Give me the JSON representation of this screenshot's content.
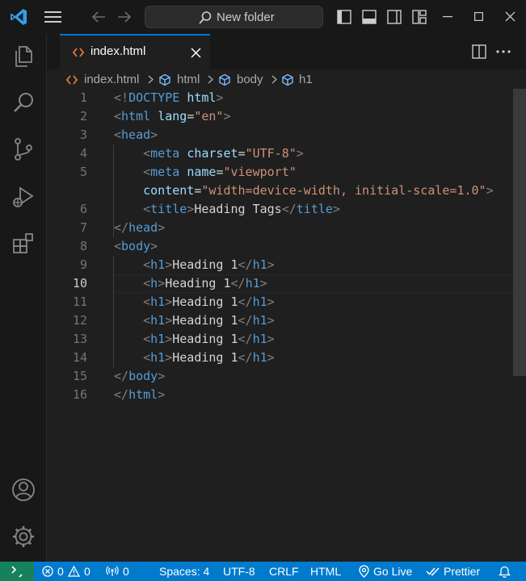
{
  "titlebar": {
    "search_label": "New folder",
    "icons": [
      "vscode-logo-icon",
      "hamburger-menu-icon",
      "back-arrow-icon",
      "forward-arrow-icon",
      "search-icon",
      "toggle-primary-sidebar-icon",
      "toggle-panel-icon",
      "toggle-secondary-sidebar-icon",
      "customize-layout-icon",
      "minimize-icon",
      "maximize-icon",
      "close-icon"
    ]
  },
  "activity_bar": {
    "items": [
      "explorer-icon",
      "search-icon",
      "source-control-icon",
      "run-debug-icon",
      "extensions-icon"
    ],
    "bottom": [
      "accounts-icon",
      "manage-gear-icon"
    ]
  },
  "tab": {
    "label": "index.html"
  },
  "breadcrumb": [
    "index.html",
    "html",
    "body",
    "h1"
  ],
  "editor": {
    "active_line": "10",
    "lines": [
      {
        "n": "1",
        "tokens": [
          {
            "c": "t",
            "v": "<!"
          },
          {
            "c": "tn",
            "v": "DOCTYPE"
          },
          {
            "c": "tx",
            "v": " "
          },
          {
            "c": "at",
            "v": "html"
          },
          {
            "c": "t",
            "v": ">"
          }
        ]
      },
      {
        "n": "2",
        "tokens": [
          {
            "c": "t",
            "v": "<"
          },
          {
            "c": "tn",
            "v": "html"
          },
          {
            "c": "tx",
            "v": " "
          },
          {
            "c": "at",
            "v": "lang"
          },
          {
            "c": "tx",
            "v": "="
          },
          {
            "c": "st",
            "v": "\"en\""
          },
          {
            "c": "t",
            "v": ">"
          }
        ]
      },
      {
        "n": "3",
        "tokens": [
          {
            "c": "t",
            "v": "<"
          },
          {
            "c": "tn",
            "v": "head"
          },
          {
            "c": "t",
            "v": ">"
          }
        ]
      },
      {
        "n": "4",
        "tokens": [
          {
            "c": "tx",
            "v": "    "
          },
          {
            "c": "t",
            "v": "<"
          },
          {
            "c": "tn",
            "v": "meta"
          },
          {
            "c": "tx",
            "v": " "
          },
          {
            "c": "at",
            "v": "charset"
          },
          {
            "c": "tx",
            "v": "="
          },
          {
            "c": "st",
            "v": "\"UTF-8\""
          },
          {
            "c": "t",
            "v": ">"
          }
        ]
      },
      {
        "n": "5",
        "tokens": [
          {
            "c": "tx",
            "v": "    "
          },
          {
            "c": "t",
            "v": "<"
          },
          {
            "c": "tn",
            "v": "meta"
          },
          {
            "c": "tx",
            "v": " "
          },
          {
            "c": "at",
            "v": "name"
          },
          {
            "c": "tx",
            "v": "="
          },
          {
            "c": "st",
            "v": "\"viewport\""
          }
        ]
      },
      {
        "n": "",
        "tokens": [
          {
            "c": "tx",
            "v": "    "
          },
          {
            "c": "at",
            "v": "content"
          },
          {
            "c": "tx",
            "v": "="
          },
          {
            "c": "st",
            "v": "\"width=device-width, initial-scale=1.0\""
          },
          {
            "c": "t",
            "v": ">"
          }
        ]
      },
      {
        "n": "6",
        "tokens": [
          {
            "c": "tx",
            "v": "    "
          },
          {
            "c": "t",
            "v": "<"
          },
          {
            "c": "tn",
            "v": "title"
          },
          {
            "c": "t",
            "v": ">"
          },
          {
            "c": "tx",
            "v": "Heading Tags"
          },
          {
            "c": "t",
            "v": "</"
          },
          {
            "c": "tn",
            "v": "title"
          },
          {
            "c": "t",
            "v": ">"
          }
        ]
      },
      {
        "n": "7",
        "tokens": [
          {
            "c": "t",
            "v": "</"
          },
          {
            "c": "tn",
            "v": "head"
          },
          {
            "c": "t",
            "v": ">"
          }
        ]
      },
      {
        "n": "8",
        "tokens": [
          {
            "c": "t",
            "v": "<"
          },
          {
            "c": "tn",
            "v": "body"
          },
          {
            "c": "t",
            "v": ">"
          }
        ]
      },
      {
        "n": "9",
        "tokens": [
          {
            "c": "tx",
            "v": "    "
          },
          {
            "c": "t",
            "v": "<"
          },
          {
            "c": "tn",
            "v": "h1"
          },
          {
            "c": "t",
            "v": ">"
          },
          {
            "c": "tx",
            "v": "Heading 1"
          },
          {
            "c": "t",
            "v": "</"
          },
          {
            "c": "tn",
            "v": "h1"
          },
          {
            "c": "t",
            "v": ">"
          }
        ]
      },
      {
        "n": "10",
        "tokens": [
          {
            "c": "tx",
            "v": "    "
          },
          {
            "c": "t",
            "v": "<"
          },
          {
            "c": "tn",
            "v": "h"
          },
          {
            "c": "t",
            "v": ">"
          },
          {
            "c": "tx",
            "v": "Heading 1"
          },
          {
            "c": "t",
            "v": "</"
          },
          {
            "c": "tn",
            "v": "h1"
          },
          {
            "c": "t",
            "v": ">"
          }
        ]
      },
      {
        "n": "11",
        "tokens": [
          {
            "c": "tx",
            "v": "    "
          },
          {
            "c": "t",
            "v": "<"
          },
          {
            "c": "tn",
            "v": "h1"
          },
          {
            "c": "t",
            "v": ">"
          },
          {
            "c": "tx",
            "v": "Heading 1"
          },
          {
            "c": "t",
            "v": "</"
          },
          {
            "c": "tn",
            "v": "h1"
          },
          {
            "c": "t",
            "v": ">"
          }
        ]
      },
      {
        "n": "12",
        "tokens": [
          {
            "c": "tx",
            "v": "    "
          },
          {
            "c": "t",
            "v": "<"
          },
          {
            "c": "tn",
            "v": "h1"
          },
          {
            "c": "t",
            "v": ">"
          },
          {
            "c": "tx",
            "v": "Heading 1"
          },
          {
            "c": "t",
            "v": "</"
          },
          {
            "c": "tn",
            "v": "h1"
          },
          {
            "c": "t",
            "v": ">"
          }
        ]
      },
      {
        "n": "13",
        "tokens": [
          {
            "c": "tx",
            "v": "    "
          },
          {
            "c": "t",
            "v": "<"
          },
          {
            "c": "tn",
            "v": "h1"
          },
          {
            "c": "t",
            "v": ">"
          },
          {
            "c": "tx",
            "v": "Heading 1"
          },
          {
            "c": "t",
            "v": "</"
          },
          {
            "c": "tn",
            "v": "h1"
          },
          {
            "c": "t",
            "v": ">"
          }
        ]
      },
      {
        "n": "14",
        "tokens": [
          {
            "c": "tx",
            "v": "    "
          },
          {
            "c": "t",
            "v": "<"
          },
          {
            "c": "tn",
            "v": "h1"
          },
          {
            "c": "t",
            "v": ">"
          },
          {
            "c": "tx",
            "v": "Heading 1"
          },
          {
            "c": "t",
            "v": "</"
          },
          {
            "c": "tn",
            "v": "h1"
          },
          {
            "c": "t",
            "v": ">"
          }
        ]
      },
      {
        "n": "15",
        "tokens": [
          {
            "c": "t",
            "v": "</"
          },
          {
            "c": "tn",
            "v": "body"
          },
          {
            "c": "t",
            "v": ">"
          }
        ]
      },
      {
        "n": "16",
        "tokens": [
          {
            "c": "t",
            "v": "</"
          },
          {
            "c": "tn",
            "v": "html"
          },
          {
            "c": "t",
            "v": ">"
          }
        ]
      }
    ]
  },
  "statusbar": {
    "errors": "0",
    "warnings": "0",
    "ports": "0",
    "spaces": "Spaces: 4",
    "encoding": "UTF-8",
    "eol": "CRLF",
    "language": "HTML",
    "go_live": "Go Live",
    "prettier": "Prettier"
  },
  "colors": {
    "accent": "#0078d4",
    "statusbar": "#007acc",
    "remote": "#16825d",
    "editor_bg": "#1f1f1f",
    "chrome_bg": "#181818",
    "tag": "#569cd6",
    "attribute": "#9cdcfe",
    "string": "#ce9178",
    "punctuation": "#808080"
  }
}
